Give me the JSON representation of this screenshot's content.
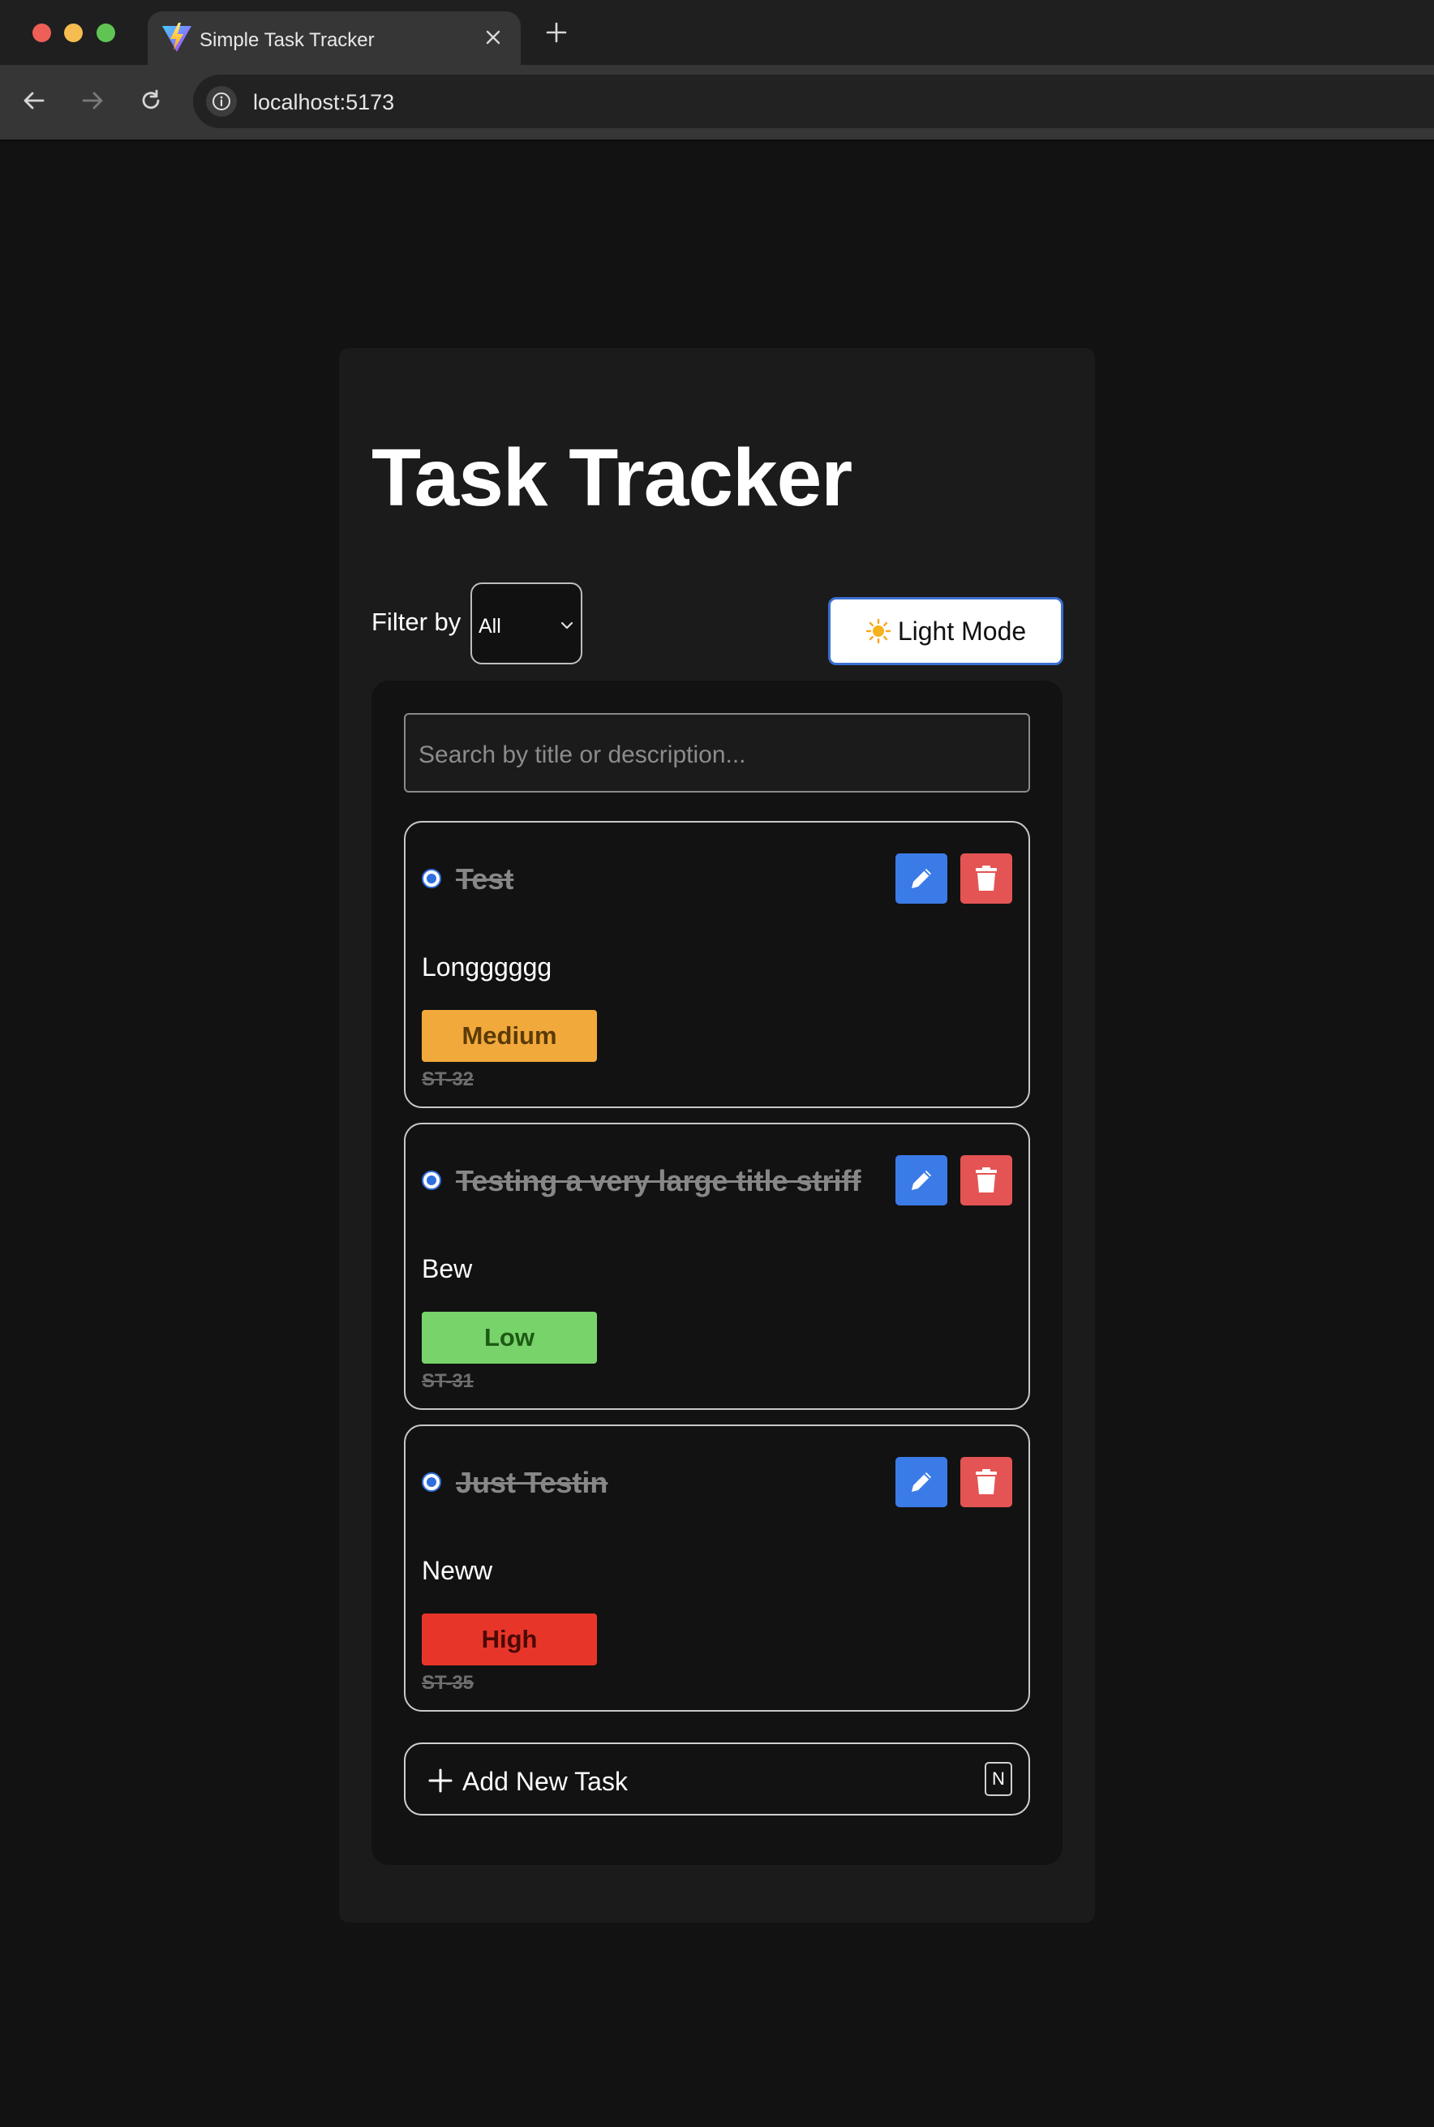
{
  "browser": {
    "tab_title": "Simple Task Tracker",
    "tab_favicon": "vite-logo-icon",
    "url": "localhost:5173"
  },
  "app": {
    "title": "Task Tracker",
    "filter": {
      "label": "Filter by",
      "selected": "All"
    },
    "theme_toggle": {
      "label": "Light Mode",
      "icon": "sun-icon"
    },
    "search": {
      "placeholder": "Search by title or description..."
    },
    "tasks": [
      {
        "title": "Test",
        "description": "Longggggg",
        "priority": "Medium",
        "priority_color": "#f2a93b",
        "priority_text_color": "#5a3b08",
        "id": "ST-32",
        "completed": true
      },
      {
        "title": "Testing a very large title striff",
        "description": "Bew",
        "priority": "Low",
        "priority_color": "#78d36a",
        "priority_text_color": "#1e5a15",
        "id": "ST-31",
        "completed": true
      },
      {
        "title": "Just Testin",
        "description": "Neww",
        "priority": "High",
        "priority_color": "#e8352a",
        "priority_text_color": "#4a0a06",
        "id": "ST-35",
        "completed": true
      }
    ],
    "add_task": {
      "label": "Add New Task",
      "shortcut": "N"
    }
  },
  "colors": {
    "edit_button": "#3b7be8",
    "delete_button": "#e45454",
    "accent_blue": "#2f6fdd"
  }
}
